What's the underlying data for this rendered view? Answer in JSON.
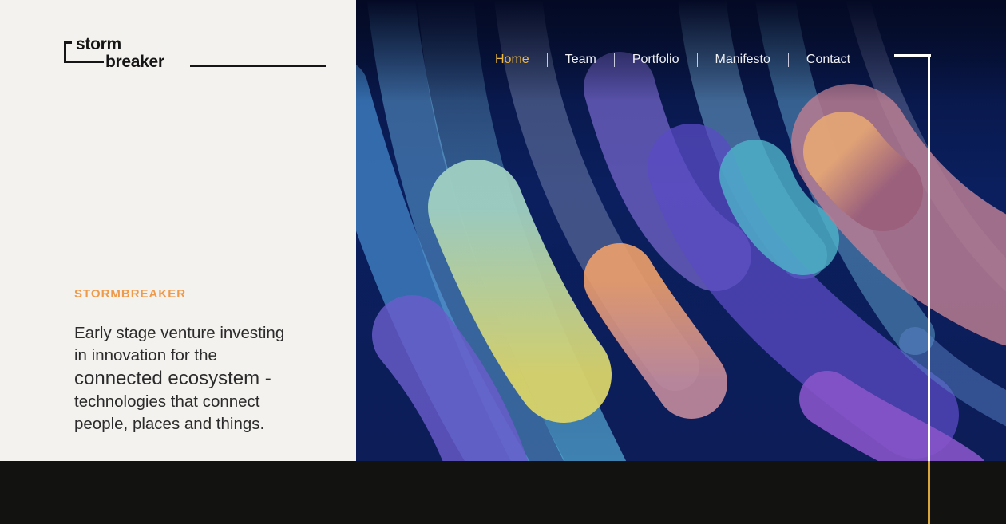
{
  "brand": {
    "logo_line1": "storm",
    "logo_line2": "breaker"
  },
  "nav": {
    "items": [
      {
        "label": "Home",
        "active": true
      },
      {
        "label": "Team",
        "active": false
      },
      {
        "label": "Portfolio",
        "active": false
      },
      {
        "label": "Manifesto",
        "active": false
      },
      {
        "label": "Contact",
        "active": false
      }
    ]
  },
  "hero": {
    "eyebrow": "STORMBREAKER",
    "tagline_lines": [
      "Early stage venture investing",
      "in innovation for the",
      "connected ecosystem -",
      "technologies that connect",
      "people, places and things."
    ]
  },
  "colors": {
    "accent_orange": "#ef9a4a",
    "nav_active": "#f0b93f",
    "panel_bg": "#f4f2ee",
    "footer_bg": "#121210",
    "gold_rule": "#d9a63c"
  }
}
